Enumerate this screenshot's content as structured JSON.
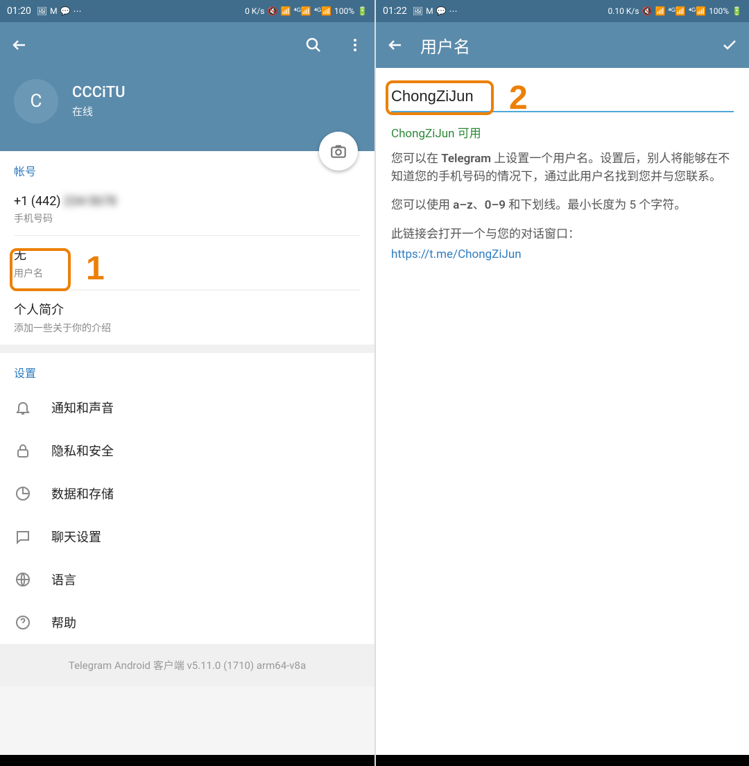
{
  "left": {
    "status": {
      "time": "01:20",
      "net": "0 K/s",
      "battery": "100%"
    },
    "profile": {
      "avatar_letter": "C",
      "name": "CCCiTU",
      "status": "在线"
    },
    "account": {
      "header": "帐号",
      "phone_prefix": "+1 (442)",
      "phone_label": "手机号码",
      "username_value": "无",
      "username_label": "用户名",
      "bio_title": "个人简介",
      "bio_hint": "添加一些关于你的介绍"
    },
    "settings": {
      "header": "设置",
      "items": [
        "通知和声音",
        "隐私和安全",
        "数据和存储",
        "聊天设置",
        "语言",
        "帮助"
      ]
    },
    "version": "Telegram Android 客户端 v5.11.0 (1710) arm64-v8a",
    "annotation": "1"
  },
  "right": {
    "status": {
      "time": "01:22",
      "net": "0.10 K/s",
      "battery": "100%"
    },
    "toolbar_title": "用户名",
    "username_value": "ChongZiJun",
    "available_text": "ChongZiJun 可用",
    "help1_a": "您可以在 ",
    "help1_b": "Telegram",
    "help1_c": " 上设置一个用户名。设置后，别人将能够在不知道您的手机号码的情况下，通过此用户名找到您并与您联系。",
    "help2_a": "您可以使用 ",
    "help2_b": "a–z",
    "help2_c": "、",
    "help2_d": "0–9",
    "help2_e": " 和下划线。最小长度为 5 个字符。",
    "help3": "此链接会打开一个与您的对话窗口：",
    "link": "https://t.me/ChongZiJun",
    "annotation": "2"
  }
}
